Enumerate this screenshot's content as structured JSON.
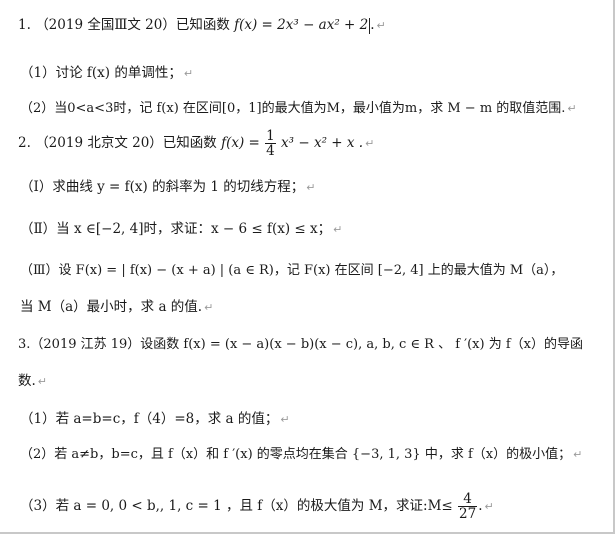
{
  "document": {
    "q1": {
      "header_num": "1.",
      "header_src": "（2019 全国Ⅲ文 20）已知函数",
      "header_func": "f(x) = 2x³ − ax² + 2",
      "header_end": ".",
      "part1": "（1）讨论 f(x) 的单调性；",
      "part2": "（2）当0<a<3时，记 f(x) 在区间[0，1]的最大值为M，最小值为m，求 M − m 的取值范围."
    },
    "q2": {
      "header_num": "2.",
      "header_src": "（2019 北京文 20）已知函数",
      "header_func_pre": "f(x) =",
      "frac_num": "1",
      "frac_den": "4",
      "header_func_post": "x³ − x² + x .",
      "part1": "（Ⅰ）求曲线 y = f(x) 的斜率为 1 的切线方程；",
      "part2": "（Ⅱ）当 x ∈[−2, 4]时，求证：x − 6 ≤ f(x) ≤ x；",
      "part3a": "（Ⅲ）设 F(x) = | f(x) − (x + a) | (a ∈ R)，记 F(x) 在区间 [−2, 4] 上的最大值为 M（a），",
      "part3b": "当 M（a）最小时，求 a 的值."
    },
    "q3": {
      "header_a": "3.（2019 江苏 19）设函数 f(x) = (x − a)(x − b)(x − c), a, b, c ∈ R 、 f ′(x) 为 f（x）的导函",
      "header_b": "数.",
      "part1": "（1）若 a=b=c，f（4）=8，求 a 的值；",
      "part2": "（2）若 a≠b，b=c，且 f（x）和 f ′(x) 的零点均在集合 {−3, 1, 3} 中，求 f（x）的极小值；",
      "part3_pre": "（3）若 a = 0, 0 < b,, 1, c = 1 ，且 f（x）的极大值为 M，求证:M≤",
      "frac_num": "4",
      "frac_den": "27",
      "part3_end": "."
    },
    "paragraph_mark": "↵"
  }
}
